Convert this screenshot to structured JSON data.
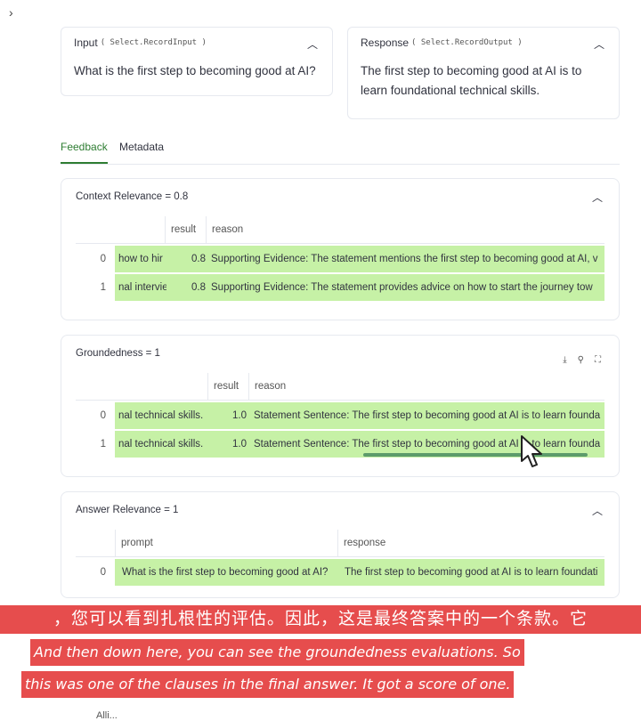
{
  "top_chevron": "›",
  "input_card": {
    "label": "Input",
    "code": "( Select.RecordInput )",
    "text": "What is the first step to becoming good at AI?"
  },
  "response_card": {
    "label": "Response",
    "code": "( Select.RecordOutput )",
    "text": "The first step to becoming good at AI is to learn foundational technical skills."
  },
  "tabs": [
    "Feedback",
    "Metadata"
  ],
  "panels": {
    "context": {
      "title": "Context Relevance = 0.8",
      "headers": [
        "result",
        "reason"
      ],
      "rows": [
        {
          "idx": "0",
          "c1": "how to hir",
          "result": "0.8",
          "reason": "Supporting Evidence: The statement mentions the first step to becoming good at AI, v"
        },
        {
          "idx": "1",
          "c1": "nal intervie",
          "result": "0.8",
          "reason": "Supporting Evidence: The statement provides advice on how to start the journey tow"
        }
      ]
    },
    "groundedness": {
      "title": "Groundedness = 1",
      "headers": [
        "result",
        "reason"
      ],
      "tools": [
        "⤓",
        "⚲",
        "⛶"
      ],
      "rows": [
        {
          "idx": "0",
          "c1": "nal technical skills.",
          "result": "1.0",
          "reason": "Statement Sentence: The first step to becoming good at AI is to learn founda"
        },
        {
          "idx": "1",
          "c1": "nal technical skills.",
          "result": "1.0",
          "reason": "Statement Sentence: The first step to becoming good at AI is to learn founda"
        }
      ]
    },
    "answer": {
      "title": "Answer Relevance = 1",
      "headers": [
        "prompt",
        "response"
      ],
      "rows": [
        {
          "idx": "0",
          "prompt": "What is the first step to becoming good at AI?",
          "response": "The first step to becoming good at AI is to learn foundati"
        }
      ]
    }
  },
  "subtitles": {
    "cn": "，您可以看到扎根性的评估。因此，这是最终答案中的一个条款。它",
    "en1": "And then down here, you can see the groundedness evaluations. So",
    "en2": "this was one of the clauses in the final answer. It got a score of one."
  },
  "bottom_fragment": "Alli..."
}
